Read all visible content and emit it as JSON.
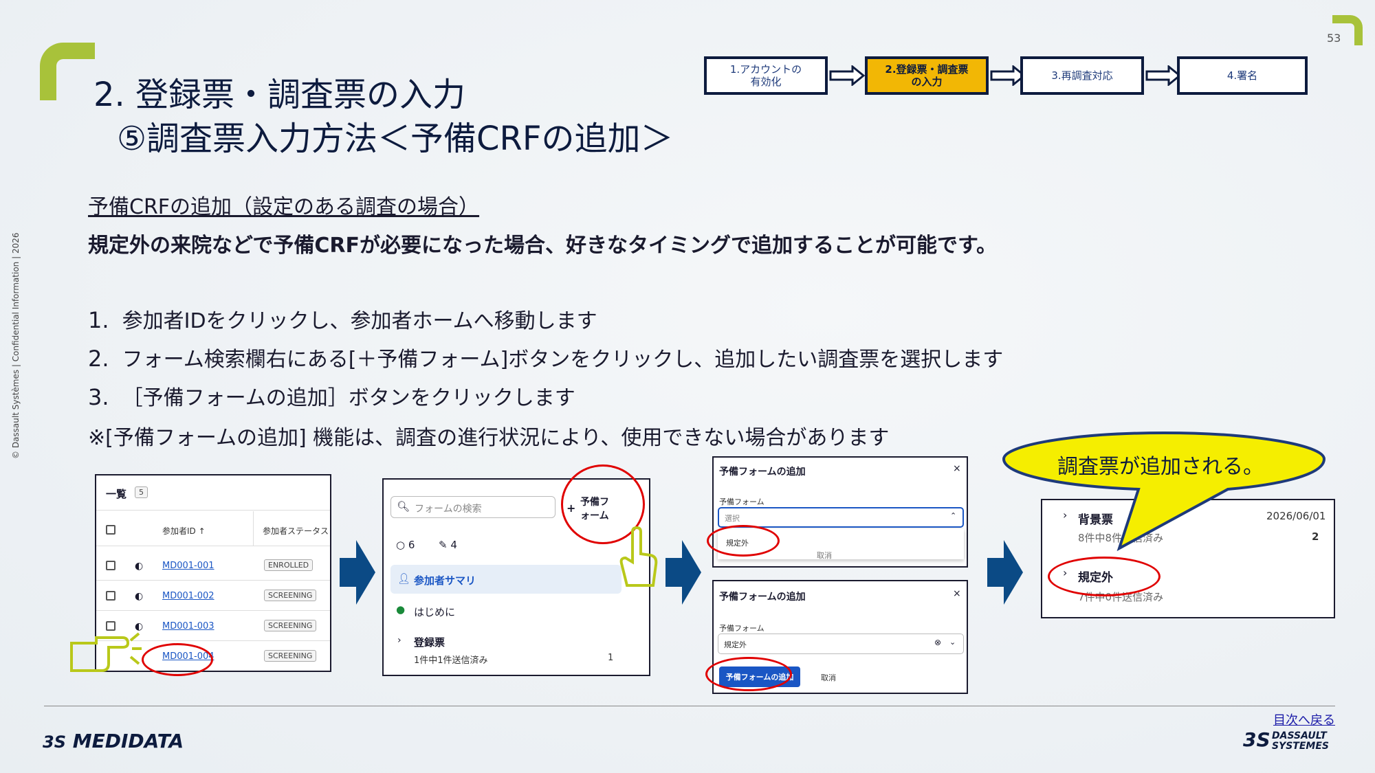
{
  "page_number": "53",
  "side_text": "© Dassault Systèmes | Confidential Information | 2026",
  "title": {
    "line1": "2. 登録票・調査票の入力",
    "line2": "⑤調査票入力方法＜予備CRFの追加＞"
  },
  "steps": [
    {
      "label_l1": "1.アカウントの",
      "label_l2": "有効化"
    },
    {
      "label_l1": "2.登録票・調査票",
      "label_l2": "の入力"
    },
    {
      "label_l1": "3.再調査対応",
      "label_l2": ""
    },
    {
      "label_l1": "4.署名",
      "label_l2": ""
    }
  ],
  "subheading": "予備CRFの追加（設定のある調査の場合）",
  "lead": "規定外の来院などで予備CRFが必要になった場合、好きなタイミングで追加することが可能です。",
  "instructions": [
    {
      "num": "1.",
      "text": "参加者IDをクリックし、参加者ホームへ移動します"
    },
    {
      "num": "2.",
      "text": "フォーム検索欄右にある[＋予備フォーム]ボタンをクリックし、追加したい調査票を選択します"
    },
    {
      "num": "3.",
      "text": "［予備フォームの追加］ボタンをクリックします"
    }
  ],
  "note": "※[予備フォームの追加] 機能は、調査の進行状況により、使用できない場合があります",
  "panel1": {
    "title": "一覧",
    "count": "5",
    "col_id": "参加者ID",
    "col_status": "参加者ステータス",
    "rows": [
      {
        "id": "MD001-001",
        "status": "ENROLLED"
      },
      {
        "id": "MD001-002",
        "status": "SCREENING"
      },
      {
        "id": "MD001-003",
        "status": "SCREENING"
      },
      {
        "id": "MD001-004",
        "status": "SCREENING"
      }
    ]
  },
  "panel2": {
    "search_placeholder": "フォームの検索",
    "add_button_l1": "予備フ",
    "add_button_l2": "ォーム",
    "count_open": "6",
    "count_edit": "4",
    "nav_summary": "参加者サマリ",
    "nav_intro": "はじめに",
    "nav_reg": "登録票",
    "nav_reg_sub": "1件中1件送信済み",
    "nav_reg_count": "1"
  },
  "panel3a": {
    "title": "予備フォームの追加",
    "field_label": "予備フォーム",
    "select_placeholder": "選択",
    "option": "規定外",
    "hidden_btn": "取消"
  },
  "panel3b": {
    "title": "予備フォームの追加",
    "field_label": "予備フォーム",
    "select_value": "規定外",
    "add_btn": "予備フォームの追加",
    "cancel_btn": "取消"
  },
  "callout": "調査票が追加される。",
  "panel4": {
    "item1": "背景票",
    "item1_date": "2026/06/01",
    "item1_sub": "8件中8件送信済み",
    "item1_count": "2",
    "item2": "規定外",
    "item2_sub": "7件中0件送信済み"
  },
  "footer": {
    "logo_left": "MEDIDATA",
    "logo_right_l1": "DASSAULT",
    "logo_right_l2": "SYSTEMES",
    "toc_link": "目次へ戻る"
  },
  "colors": {
    "accent_green": "#a8c23a",
    "navy": "#0d1b3e",
    "active_step": "#f2b705",
    "flow_arrow": "#0b4a85",
    "highlight_red": "#e00000",
    "callout_fill": "#f5ee00"
  }
}
